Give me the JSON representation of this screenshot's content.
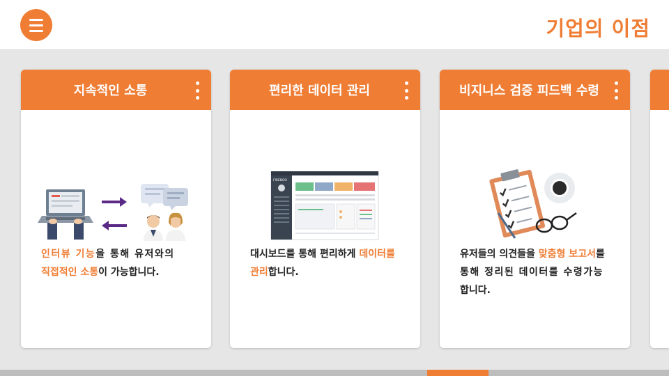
{
  "header": {
    "title": "기업의 이점",
    "menu_icon": "hamburger-menu-icon"
  },
  "cards": [
    {
      "title": "지속적인 소통",
      "desc": {
        "line1": [
          {
            "text": "인터뷰 기능",
            "highlight": true
          },
          {
            "text": "을 통해 유저와의",
            "highlight": false
          }
        ],
        "line2": [
          {
            "text": "직접적인 소통",
            "highlight": true
          },
          {
            "text": "이 가능합니다.",
            "highlight": false
          }
        ]
      }
    },
    {
      "title": "편리한 데이터 관리",
      "desc": {
        "line1": [
          {
            "text": "대시보드를 통해 편리하게 ",
            "highlight": false
          },
          {
            "text": "데이터를",
            "highlight": true
          }
        ],
        "line2": [
          {
            "text": "관리",
            "highlight": true
          },
          {
            "text": "합니다.",
            "highlight": false
          }
        ]
      },
      "dashboard_logo": "FIREBOO"
    },
    {
      "title": "비지니스 검증 피드백 수령",
      "desc": {
        "line1": [
          {
            "text": "유저들의 의견들을 ",
            "highlight": false
          },
          {
            "text": "맞춤형 보고서",
            "highlight": true
          },
          {
            "text": "를",
            "highlight": false
          }
        ],
        "line2": [
          {
            "text": "통해 정리된 데이터를 수령가능",
            "highlight": false
          }
        ],
        "line3": [
          {
            "text": "합니다.",
            "highlight": false
          }
        ]
      }
    }
  ],
  "theme": {
    "accent": "#ef7d34",
    "background": "#e6e6e6",
    "purple_arrow": "#5b2a86"
  },
  "scrollbar": {
    "position_fraction": 0.67
  }
}
